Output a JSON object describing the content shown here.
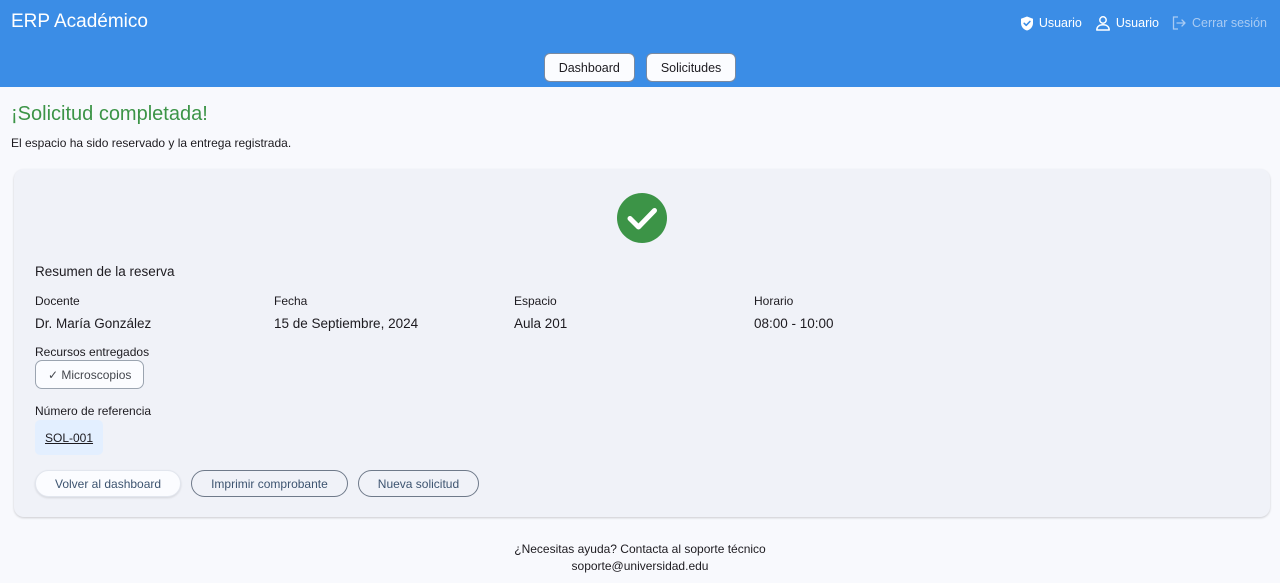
{
  "header": {
    "app_title": "ERP Académico",
    "role_label": "Usuario",
    "user_label": "Usuario",
    "logout_label": "Cerrar sesión"
  },
  "nav": {
    "dashboard_label": "Dashboard",
    "requests_label": "Solicitudes"
  },
  "page": {
    "title": "¡Solicitud completada!",
    "subtitle": "El espacio ha sido reservado y la entrega registrada."
  },
  "summary": {
    "title": "Resumen de la reserva",
    "fields": [
      {
        "label": "Docente",
        "value": "Dr. María González"
      },
      {
        "label": "Fecha",
        "value": "15 de Septiembre, 2024"
      },
      {
        "label": "Espacio",
        "value": "Aula 201"
      },
      {
        "label": "Horario",
        "value": "08:00 - 10:00"
      }
    ],
    "resources_label": "Recursos entregados",
    "resources": [
      "✓ Microscopios"
    ],
    "reference_label": "Número de referencia",
    "reference_value": "SOL-001"
  },
  "actions": {
    "back_label": "Volver al dashboard",
    "print_label": "Imprimir comprobante",
    "new_label": "Nueva solicitud"
  },
  "footer": {
    "help_text": "¿Necesitas ayuda? Contacta al soporte técnico",
    "email": "soporte@universidad.edu"
  },
  "icons": {
    "role": "shield-check-icon",
    "user": "person-icon",
    "logout": "logout-icon",
    "success": "check-circle-icon"
  },
  "colors": {
    "header_bg": "#3b8de6",
    "success_green": "#3c9447",
    "card_bg": "#f0f2f8",
    "reference_bg": "#e3efff"
  }
}
